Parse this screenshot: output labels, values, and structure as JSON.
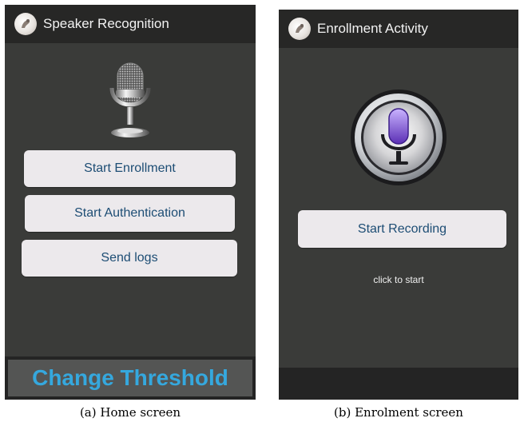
{
  "home_screen": {
    "title": "Speaker Recognition",
    "icon": "app-logo-icon",
    "mic_icon": "microphone-icon",
    "buttons": {
      "start_enrollment": "Start Enrollment",
      "start_authentication": "Start Authentication",
      "send_logs": "Send logs"
    },
    "change_threshold": "Change Threshold"
  },
  "enrolment_screen": {
    "title": "Enrollment Activity",
    "icon": "app-logo-icon",
    "mic_icon": "siri-microphone-icon",
    "start_recording": "Start Recording",
    "status": "click to start"
  },
  "captions": {
    "home": "(a) Home screen",
    "enrolment": "(b) Enrolment screen"
  },
  "colors": {
    "screen_background": "#3a3b39",
    "action_bar": "#272726",
    "button_background": "#ece9ec",
    "button_text": "#1d4d74",
    "threshold_text": "#35a8de"
  }
}
